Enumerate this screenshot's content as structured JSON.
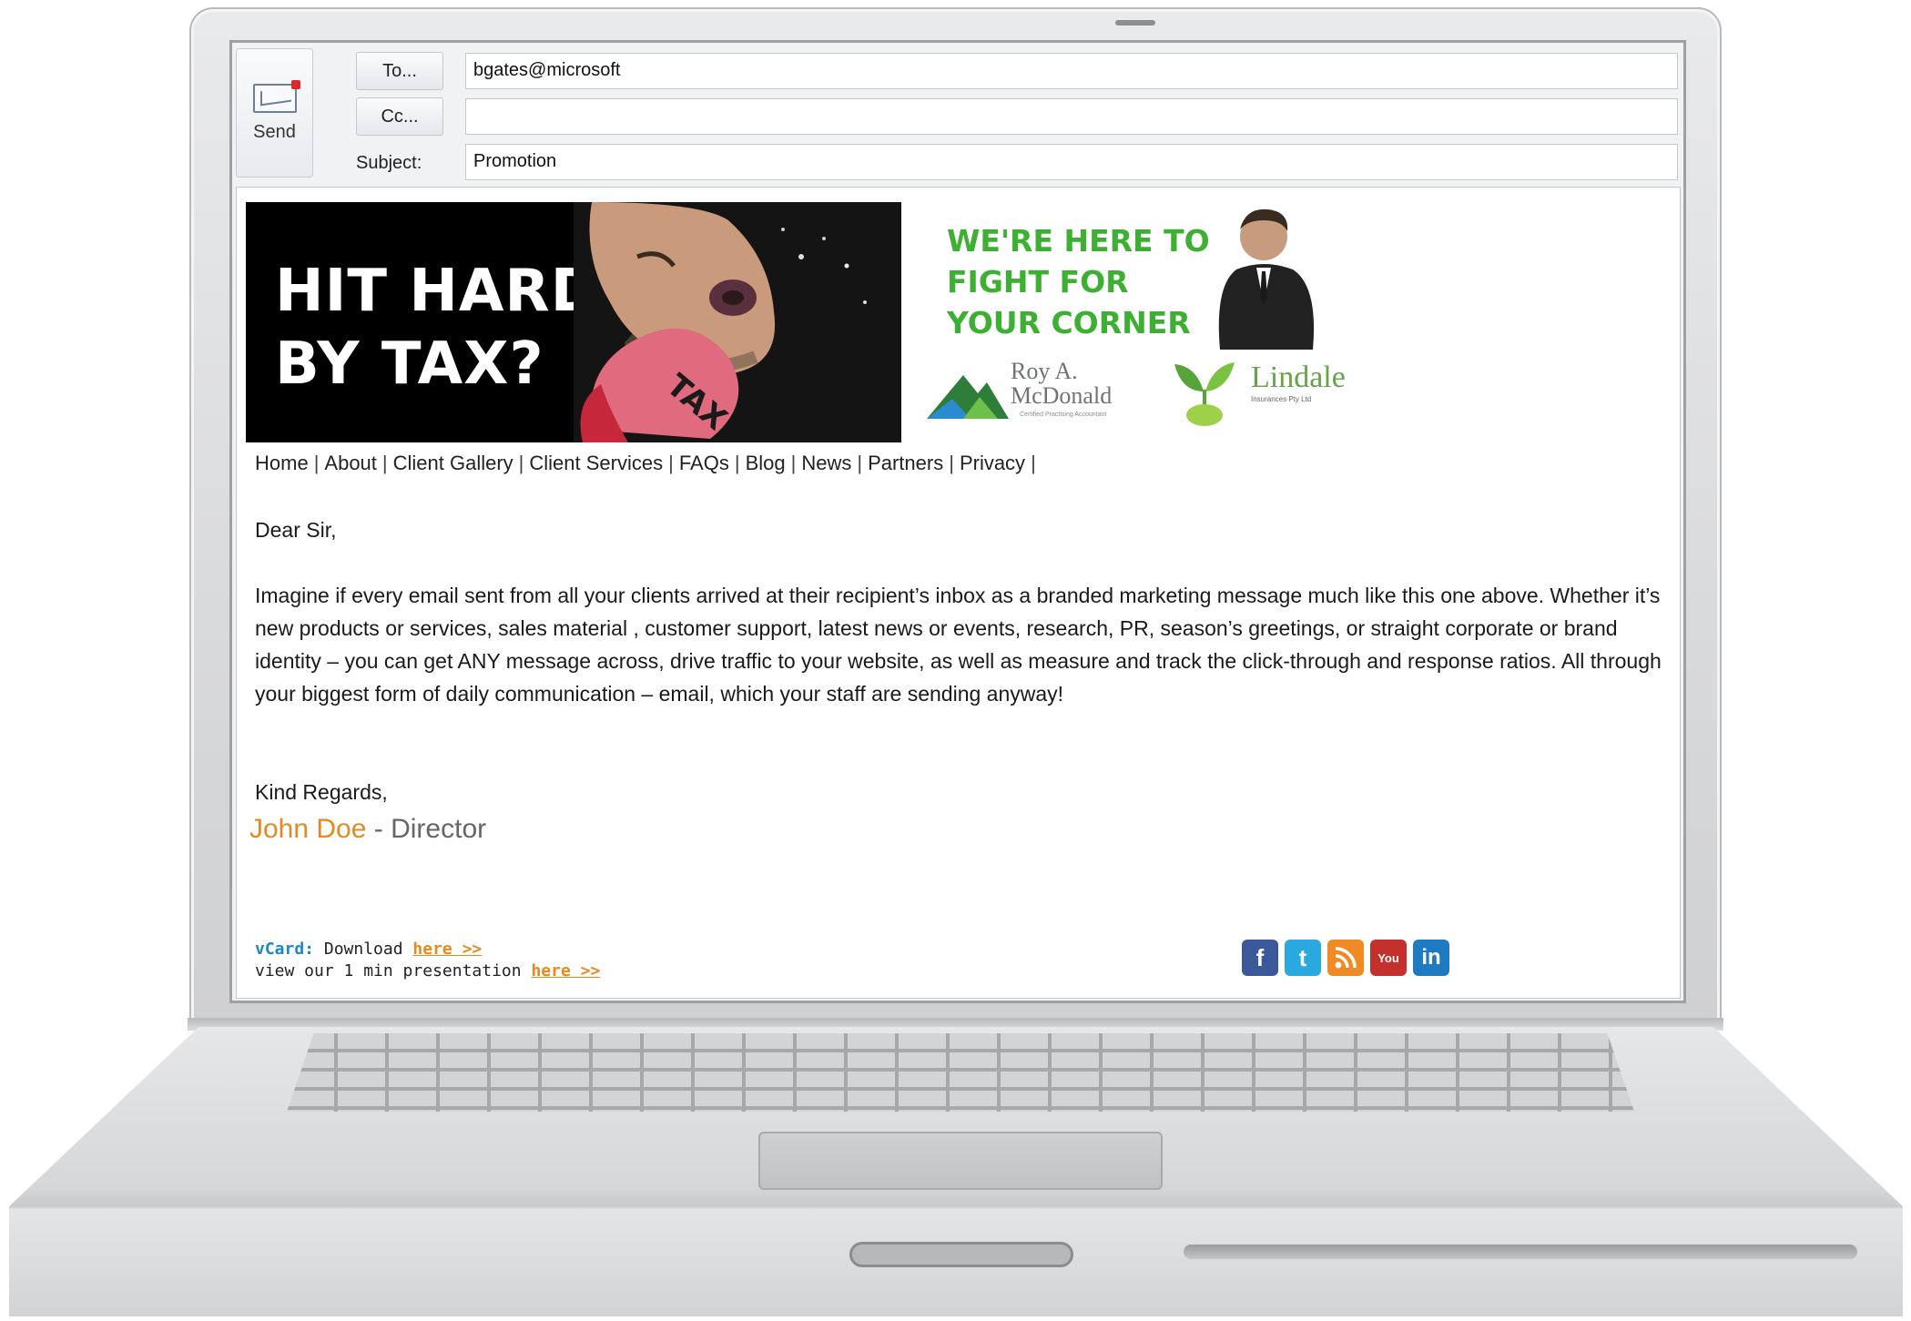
{
  "compose": {
    "send_label": "Send",
    "to_button": "To...",
    "cc_button": "Cc...",
    "subject_label": "Subject:",
    "to_value": "bgates@microsoft",
    "cc_value": "",
    "subject_value": "Promotion"
  },
  "banner": {
    "headline_line1": "HIT HARD",
    "headline_line2": "BY TAX?",
    "glove_text": "TAX",
    "promo_line1": "WE'RE HERE TO",
    "promo_line2": "FIGHT FOR",
    "promo_line3": "YOUR CORNER",
    "logo1_name_line1": "Roy A.",
    "logo1_name_line2": "McDonald",
    "logo1_sub": "Certified Practising Accountant",
    "logo2_name": "Lindale",
    "logo2_sub": "Insurances Pty Ltd"
  },
  "nav": {
    "items": [
      "Home",
      "About",
      "Client Gallery",
      "Client Services",
      "FAQs",
      "Blog",
      "News",
      "Partners",
      "Privacy"
    ],
    "separator": "|"
  },
  "body": {
    "greeting": "Dear Sir,",
    "paragraph": "Imagine if every email sent from all your clients arrived at their recipient’s inbox as a branded marketing message much like this one above. Whether it’s new products or services, sales material , customer support, latest news or events, research, PR, season’s greetings, or straight corporate or brand identity – you can get ANY message across, drive traffic to your website, as well as measure and track the click-through and response ratios. All through your biggest form of daily communication – email, which your staff are sending anyway!",
    "closing": "Kind Regards,",
    "signature_name": "John Doe",
    "signature_title": " - Director"
  },
  "footer": {
    "vcard_label": "vCard:",
    "vcard_text": " Download ",
    "vcard_link": "here >>",
    "presentation_text": "view our 1 min presentation ",
    "presentation_link": "here >>",
    "social": [
      {
        "icon": "facebook-icon",
        "glyph": "f",
        "color": "#3b5998"
      },
      {
        "icon": "twitter-icon",
        "glyph": "t",
        "color": "#2aa9e0"
      },
      {
        "icon": "rss-icon",
        "glyph": "",
        "color": "#f08a24"
      },
      {
        "icon": "youtube-icon",
        "glyph": "You",
        "color": "#c4302b"
      },
      {
        "icon": "linkedin-icon",
        "glyph": "in",
        "color": "#1f7bc1"
      }
    ]
  },
  "colors": {
    "promo_green": "#3db034",
    "signature_orange": "#e58a20",
    "vcard_blue": "#1d86c5"
  }
}
